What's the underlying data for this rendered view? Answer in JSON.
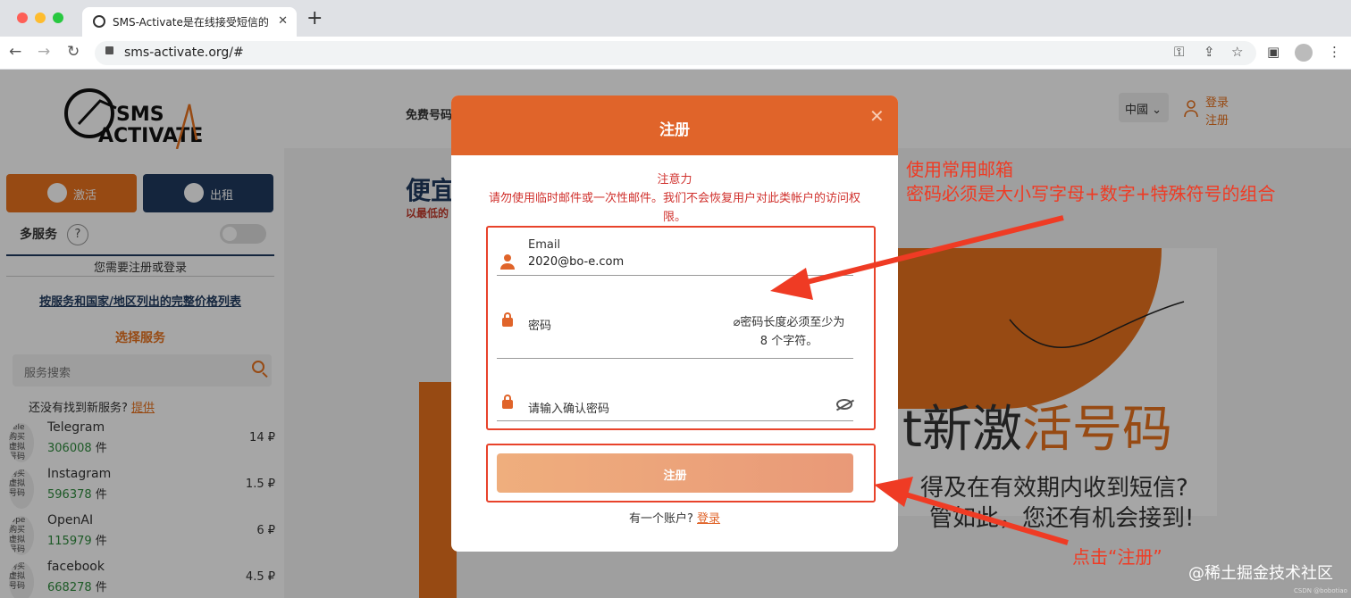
{
  "browser": {
    "tab_title": "SMS-Activate是在线接受短信的",
    "tab_close": "✕",
    "new_tab": "+",
    "url": "sms-activate.org/#"
  },
  "sidebar": {
    "activate_label": "激活",
    "rent_label": "出租",
    "multi_service": "多服务",
    "help": "?",
    "need_register": "您需要注册或登录",
    "price_list": "按服务和国家/地区列出的完整价格列表",
    "choose_service": "选择服务",
    "search_placeholder": "服务搜索",
    "not_found": "还没有找到新服务?",
    "suggest": "提供",
    "services": [
      {
        "name": "Telegram",
        "count": "306008",
        "unit": "件",
        "price": "14 ₽",
        "icon_text": "Tele 购买 虚拟 号码"
      },
      {
        "name": "Instagram",
        "count": "596378",
        "unit": "件",
        "price": "1.5 ₽",
        "icon_text": "购买 虚拟 号码"
      },
      {
        "name": "OpenAI",
        "count": "115979",
        "unit": "件",
        "price": "6 ₽",
        "icon_text": "Ope 购买 虚拟 号码"
      },
      {
        "name": "facebook",
        "count": "668278",
        "unit": "件",
        "price": "4.5 ₽",
        "icon_text": "购买 虚拟 号码"
      }
    ]
  },
  "header": {
    "menu_free_numbers": "免费号码",
    "country": "中國",
    "login": "登录",
    "register": "注册"
  },
  "hero": {
    "title_partial": "便宜",
    "subtitle_partial": "以最低的",
    "big_text_dark": "t新激",
    "big_text_orange": "活号码",
    "line2": "得及在有效期内收到短信?",
    "line3": "管如此，您还有机会接到!"
  },
  "modal": {
    "title": "注册",
    "close": "✕",
    "notice_title": "注意力",
    "notice_body": "请勿使用临时邮件或一次性邮件。我们不会恢复用户对此类帐户的访问权限。",
    "email_label": "Email",
    "email_value": "2020@bo-e.com",
    "password_label": "密码",
    "password_hint": "密码长度必须至少为 8 个字符。",
    "confirm_placeholder": "请输入确认密码",
    "submit_label": "注册",
    "have_account": "有一个账户?",
    "login_link": "登录"
  },
  "annotations": {
    "line1": "使用常用邮箱",
    "line2": "密码必须是大小写字母+数字+特殊符号的组合",
    "click_register": "点击“注册”",
    "color": "#ef3b24"
  },
  "watermark": {
    "main": "@稀土掘金技术社区",
    "small": "CSDN @bobotiao"
  }
}
